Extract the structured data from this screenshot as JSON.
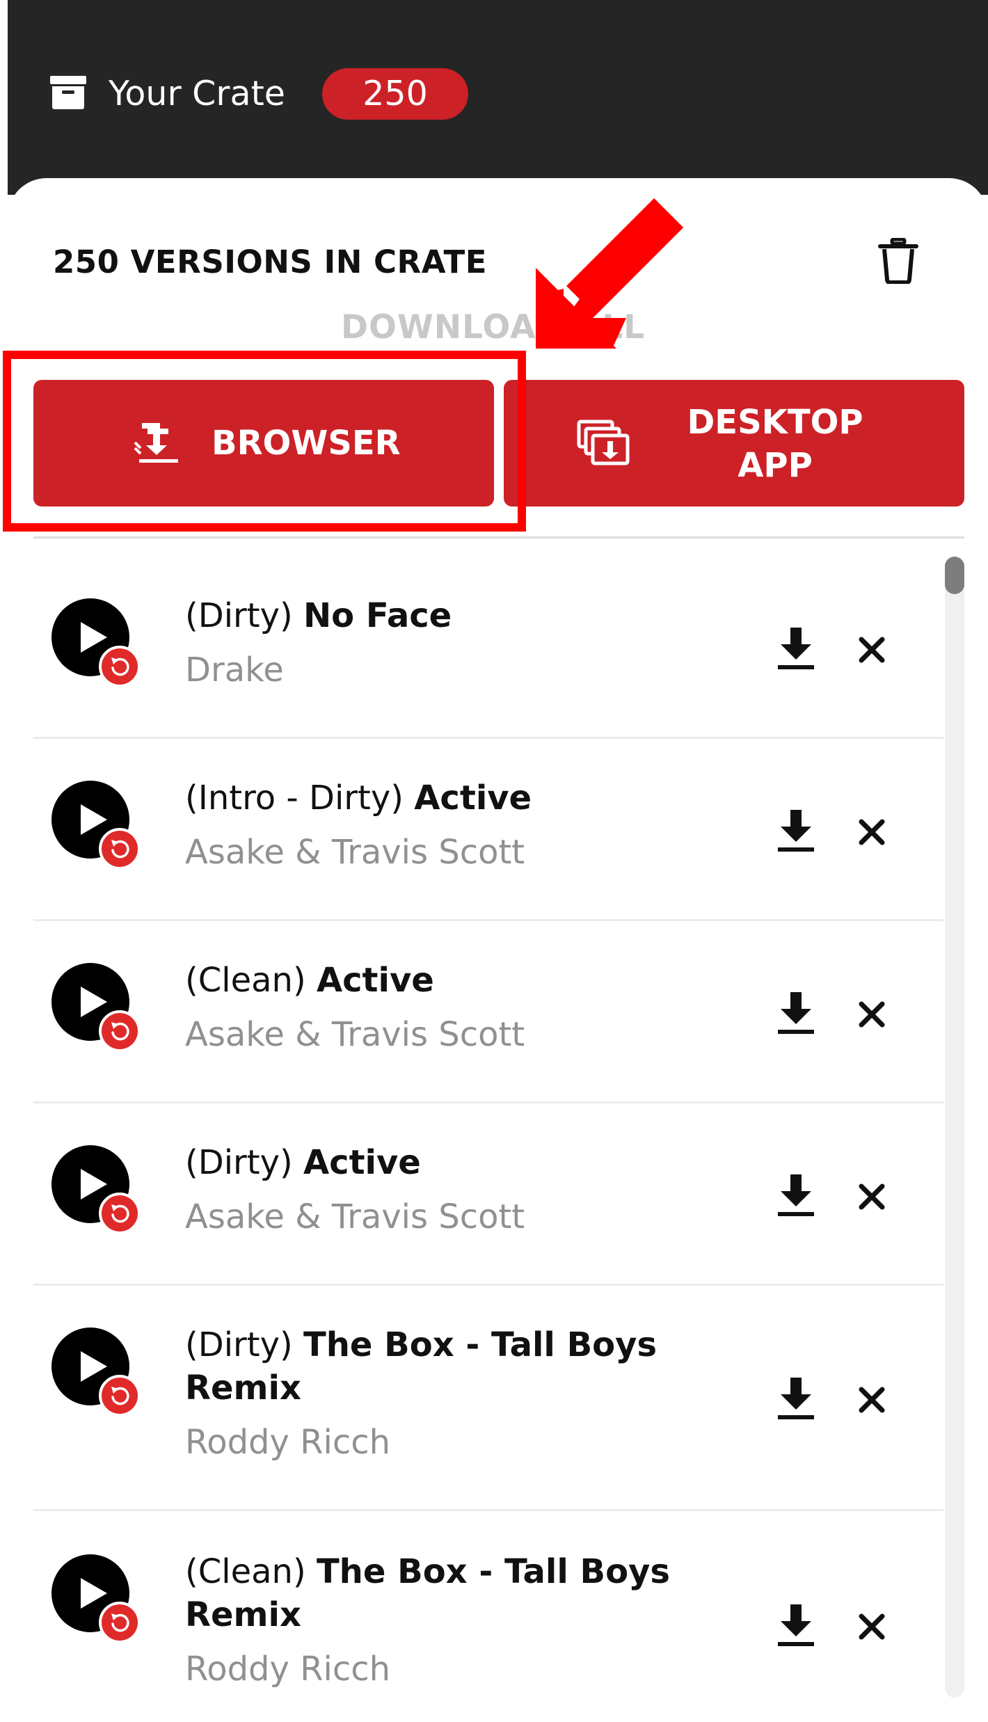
{
  "header": {
    "title": "Your Crate",
    "count_badge": "250",
    "icon": "crate-box-icon"
  },
  "panel": {
    "heading": "250 VERSIONS IN CRATE",
    "clear_icon": "trash-icon",
    "download_all_label": "DOWNLOAD ALL",
    "browser_button": {
      "label": "BROWSER",
      "icon": "browser-download-icon"
    },
    "desktop_button": {
      "label_line1": "DESKTOP",
      "label_line2": "APP",
      "icon": "desktop-app-download-icon"
    }
  },
  "tracks": [
    {
      "version": "(Dirty)",
      "title": "No Face",
      "artist": "Drake"
    },
    {
      "version": "(Intro - Dirty)",
      "title": "Active",
      "artist": "Asake & Travis Scott"
    },
    {
      "version": "(Clean)",
      "title": "Active",
      "artist": "Asake & Travis Scott"
    },
    {
      "version": "(Dirty)",
      "title": "Active",
      "artist": "Asake & Travis Scott"
    },
    {
      "version": "(Dirty)",
      "title": "The Box - Tall Boys Remix",
      "artist": "Roddy Ricch"
    },
    {
      "version": "(Clean)",
      "title": "The Box - Tall Boys Remix",
      "artist": "Roddy Ricch"
    }
  ],
  "colors": {
    "brand_red": "#cd2128",
    "header_bg": "#252525",
    "annotation_red": "#ff0000",
    "artist_gray": "#909090"
  }
}
